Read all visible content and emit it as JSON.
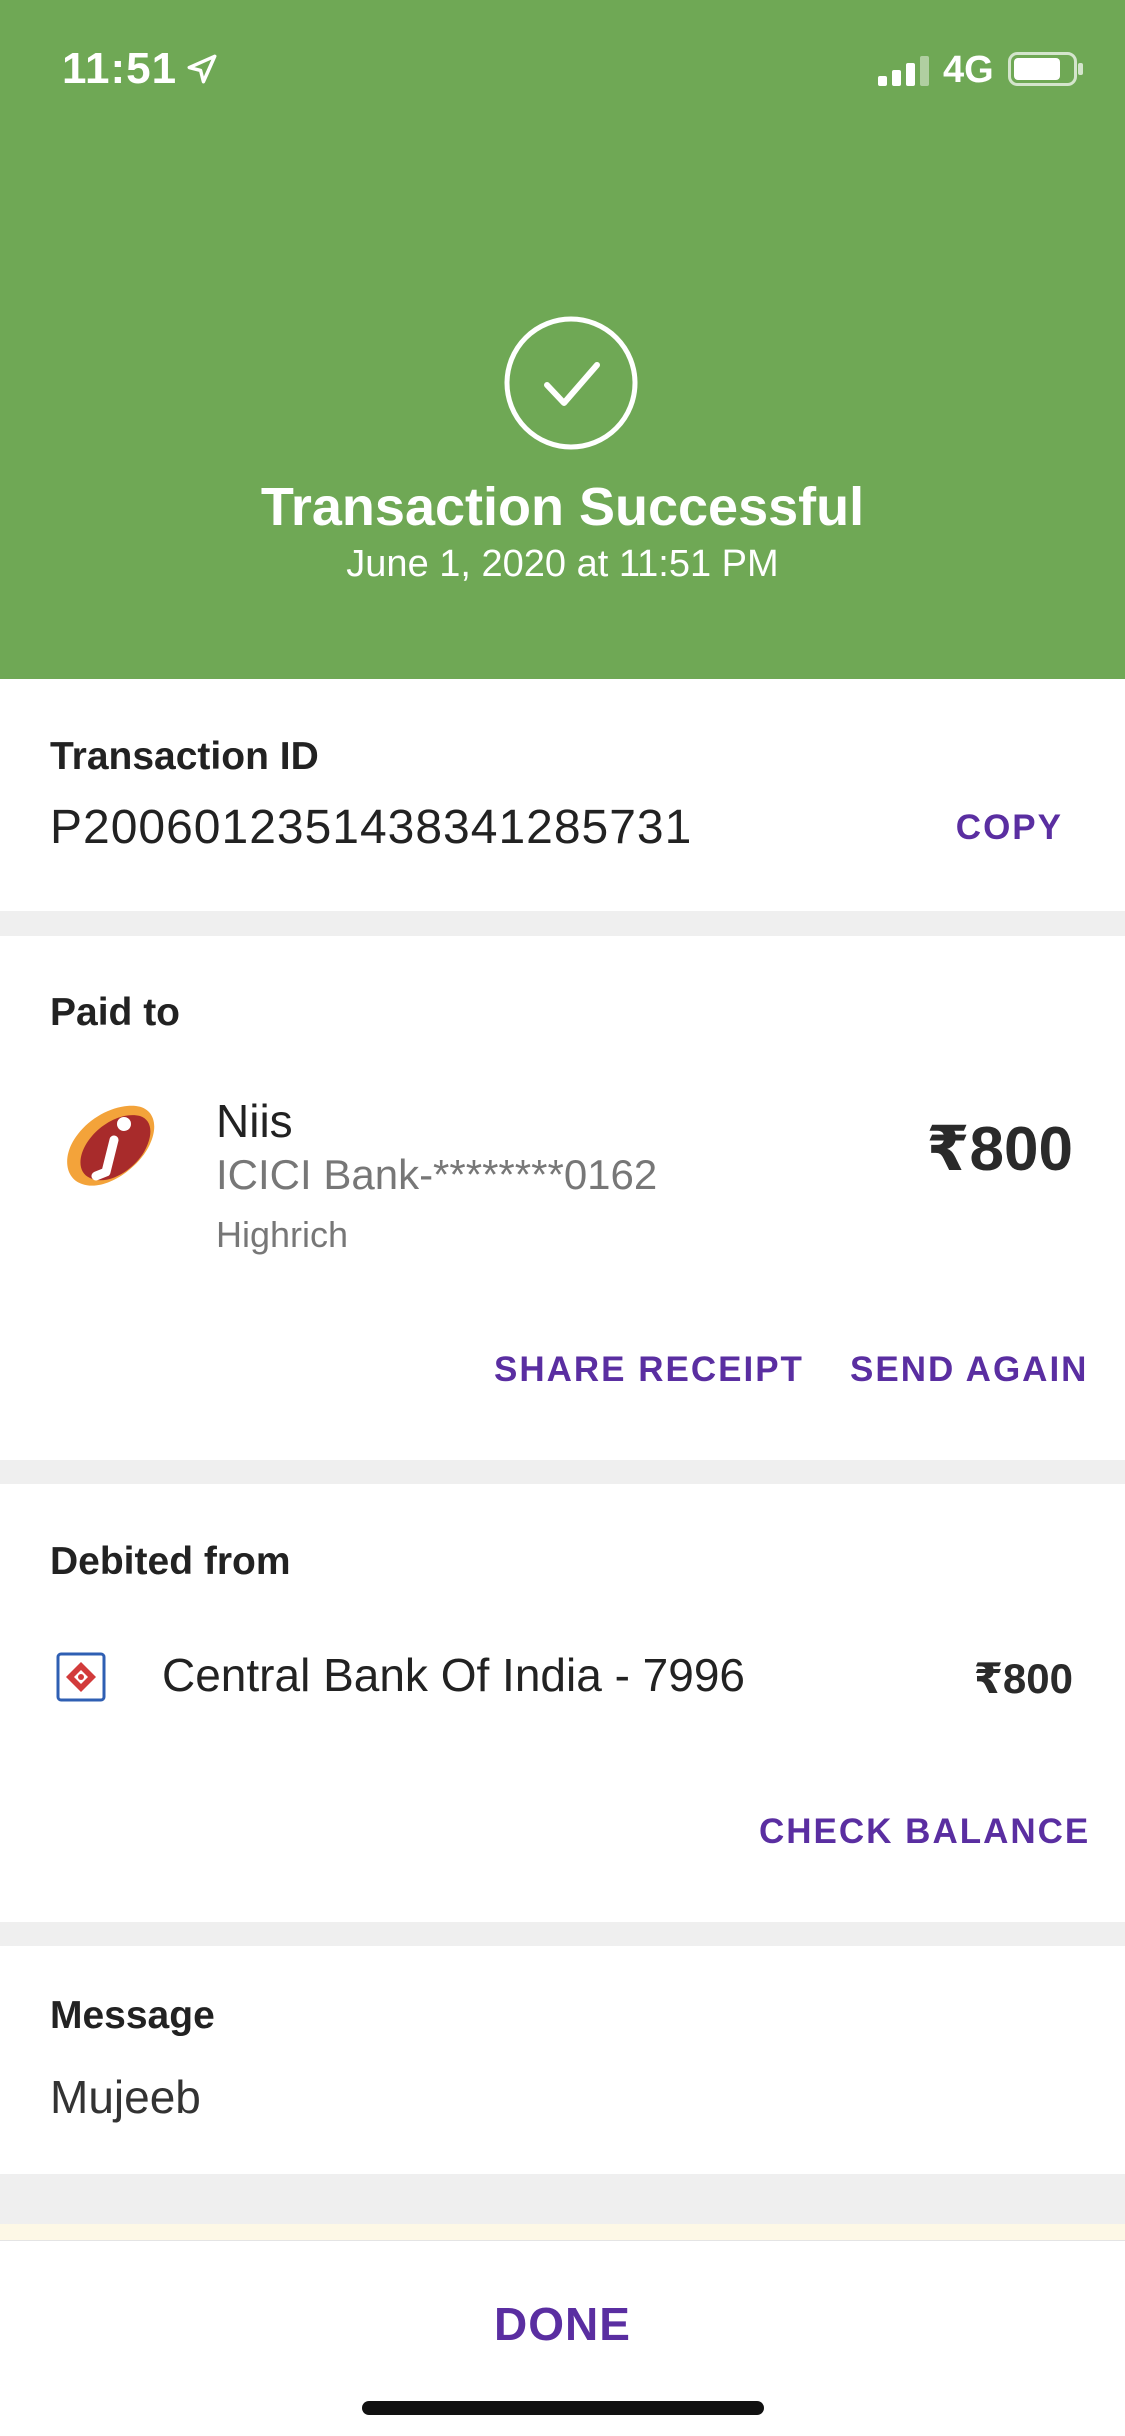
{
  "status_bar": {
    "time": "11:51",
    "network": "4G"
  },
  "header": {
    "title": "Transaction Successful",
    "date": "June 1, 2020 at 11:51 PM",
    "icon": "check-circle-icon",
    "background_color": "#6fa855"
  },
  "transaction": {
    "id_label": "Transaction ID",
    "id_value": "P2006012351438341285731",
    "copy_label": "COPY"
  },
  "paid_to": {
    "section_label": "Paid to",
    "name": "Niis",
    "account": "ICICI Bank-********0162",
    "subtitle": "Highrich",
    "amount": "₹800",
    "share_label": "SHARE RECEIPT",
    "send_again_label": "SEND AGAIN",
    "logo_icon": "icici-bank-logo"
  },
  "debited_from": {
    "section_label": "Debited from",
    "bank": "Central Bank Of India - 7996",
    "amount": "₹800",
    "check_balance_label": "CHECK BALANCE",
    "logo_icon": "central-bank-logo"
  },
  "message": {
    "label": "Message",
    "text": "Mujeeb"
  },
  "footer": {
    "done_label": "DONE"
  },
  "colors": {
    "accent": "#5a2ea1",
    "success": "#6fa855"
  }
}
